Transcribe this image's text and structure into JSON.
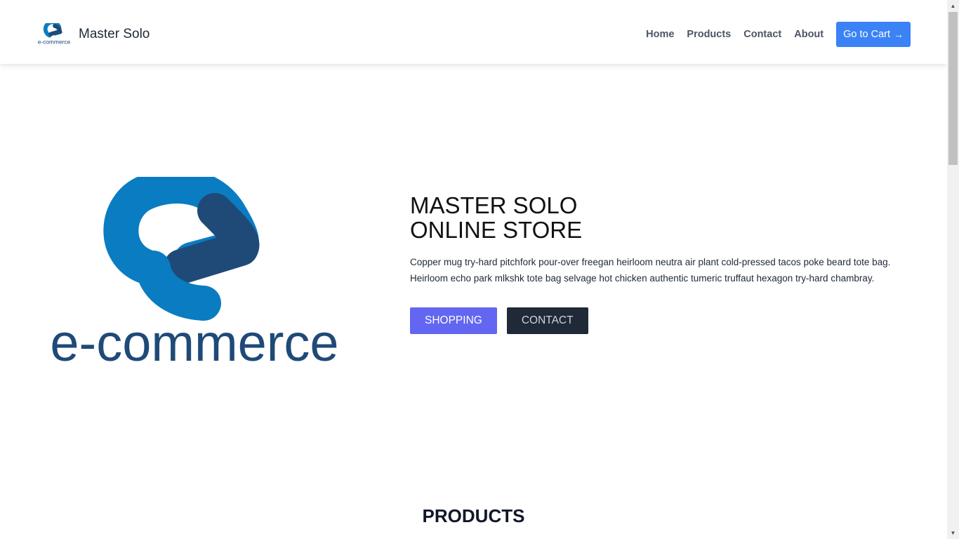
{
  "header": {
    "brand_name": "Master Solo",
    "brand_logo_text": "e-commerce",
    "nav": [
      "Home",
      "Products",
      "Contact",
      "About"
    ],
    "cart_label": "Go to Cart",
    "cart_icon": "arrow-right-icon"
  },
  "hero": {
    "logo_text": "e-commerce",
    "title_line1": "MASTER SOLO",
    "title_line2": "ONLINE STORE",
    "description": "Copper mug try-hard pitchfork pour-over freegan heirloom neutra air plant cold-pressed tacos poke beard tote bag. Heirloom echo park mlkshk tote bag selvage hot chicken authentic tumeric truffaut hexagon try-hard chambray.",
    "shop_label": "SHOPPING",
    "contact_label": "CONTACT"
  },
  "products": {
    "title": "PRODUCTS"
  },
  "colors": {
    "primary_blue": "#3b82f6",
    "indigo": "#6366f1",
    "dark": "#1f2937",
    "logo_light_blue": "#0a7cc1",
    "logo_dark_blue": "#1f4a78"
  }
}
